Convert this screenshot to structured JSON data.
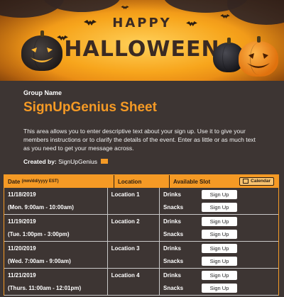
{
  "banner": {
    "line1": "HAPPY",
    "line2": "HALLOWEEN",
    "colors": {
      "orange": "#f7a51c",
      "dark": "#3a2a23"
    }
  },
  "group_name": "Group Name",
  "sheet_title": "SignUpGenius Sheet",
  "description": "This area allows you to enter descriptive text about your sign up. Use it to give your members instructions or to clarify the details of the event. Enter as little or as much text as you need to get your message across.",
  "created_by": {
    "label": "Created by:",
    "name": "SignUpGenius",
    "icon": "email-icon"
  },
  "accent_color": "#f59a25",
  "table": {
    "headers": {
      "date": "Date",
      "date_fmt": "(mm/dd/yyyy EST)",
      "location": "Location",
      "slot": "Available Slot",
      "calendar": "Calendar"
    },
    "signup_label": "Sign Up",
    "rows": [
      {
        "date": "11/18/2019",
        "time": "(Mon. 9:00am - 10:00am)",
        "location": "Location 1",
        "slots": [
          "Drinks",
          "Snacks"
        ]
      },
      {
        "date": "11/19/2019",
        "time": "(Tue. 1:00pm - 3:00pm)",
        "location": "Location 2",
        "slots": [
          "Drinks",
          "Snacks"
        ]
      },
      {
        "date": "11/20/2019",
        "time": "(Wed. 7:00am - 9:00am)",
        "location": "Location 3",
        "slots": [
          "Drinks",
          "Snacks"
        ]
      },
      {
        "date": "11/21/2019",
        "time": "(Thurs. 11:00am - 12:01pm)",
        "location": "Location 4",
        "slots": [
          "Drinks",
          "Snacks"
        ]
      }
    ]
  }
}
